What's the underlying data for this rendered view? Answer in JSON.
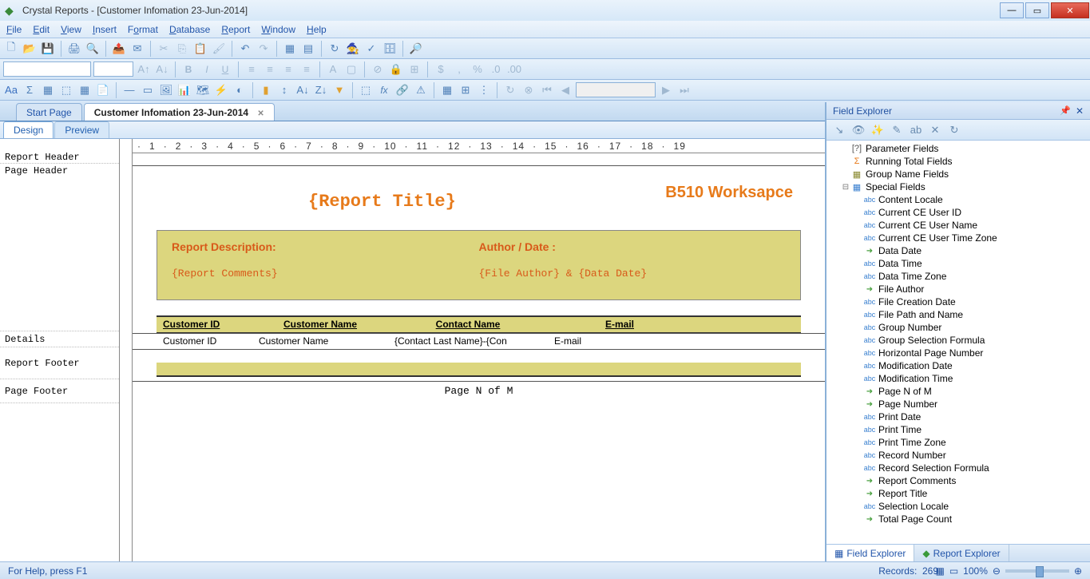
{
  "app": {
    "title": "Crystal Reports - [Customer Infomation 23-Jun-2014]"
  },
  "menu": [
    "File",
    "Edit",
    "View",
    "Insert",
    "Format",
    "Database",
    "Report",
    "Window",
    "Help"
  ],
  "tabs": {
    "start": "Start Page",
    "doc": "Customer Infomation 23-Jun-2014"
  },
  "subtabs": {
    "design": "Design",
    "preview": "Preview"
  },
  "sections": {
    "report_header": "Report Header",
    "page_header": "Page Header",
    "details": "Details",
    "report_footer": "Report Footer",
    "page_footer": "Page Footer"
  },
  "design": {
    "report_title": "{Report Title}",
    "workspace": "B510 Worksapce",
    "info": {
      "desc_label": "Report Description:",
      "author_label": "Author / Date :",
      "comments": "{Report Comments}",
      "author_fields": "{File Author} & {Data Date}"
    },
    "columns": {
      "cust_id": "Customer ID",
      "cust_name": "Customer Name",
      "contact": "Contact Name",
      "email": "E-mail"
    },
    "detail_fields": {
      "cust_id": "Customer ID",
      "cust_name": "Customer Name",
      "contact": "{Contact Last Name}-{Con",
      "email": "E-mail"
    },
    "page_n": "Page N of M"
  },
  "panel": {
    "title": "Field Explorer",
    "groups": {
      "parameter": "Parameter Fields",
      "running": "Running Total Fields",
      "group_name": "Group Name Fields",
      "special": "Special Fields"
    },
    "special_fields": [
      {
        "icon": "abc",
        "label": "Content Locale"
      },
      {
        "icon": "abc",
        "label": "Current CE User ID"
      },
      {
        "icon": "abc",
        "label": "Current CE User Name"
      },
      {
        "icon": "abc",
        "label": "Current CE User Time Zone"
      },
      {
        "icon": "arrow",
        "label": "Data Date"
      },
      {
        "icon": "abc",
        "label": "Data Time"
      },
      {
        "icon": "abc",
        "label": "Data Time Zone"
      },
      {
        "icon": "arrow",
        "label": "File Author"
      },
      {
        "icon": "abc",
        "label": "File Creation Date"
      },
      {
        "icon": "abc",
        "label": "File Path and Name"
      },
      {
        "icon": "abc",
        "label": "Group Number"
      },
      {
        "icon": "abc",
        "label": "Group Selection Formula"
      },
      {
        "icon": "abc",
        "label": "Horizontal Page Number"
      },
      {
        "icon": "abc",
        "label": "Modification Date"
      },
      {
        "icon": "abc",
        "label": "Modification Time"
      },
      {
        "icon": "arrow",
        "label": "Page N of M"
      },
      {
        "icon": "arrow",
        "label": "Page Number"
      },
      {
        "icon": "abc",
        "label": "Print Date"
      },
      {
        "icon": "abc",
        "label": "Print Time"
      },
      {
        "icon": "abc",
        "label": "Print Time Zone"
      },
      {
        "icon": "abc",
        "label": "Record Number"
      },
      {
        "icon": "abc",
        "label": "Record Selection Formula"
      },
      {
        "icon": "arrow",
        "label": "Report Comments"
      },
      {
        "icon": "arrow",
        "label": "Report Title"
      },
      {
        "icon": "abc",
        "label": "Selection Locale"
      },
      {
        "icon": "arrow",
        "label": "Total Page Count"
      }
    ],
    "tabs": {
      "field": "Field Explorer",
      "report": "Report Explorer"
    }
  },
  "status": {
    "help": "For Help, press F1",
    "records_label": "Records:",
    "records": "269",
    "zoom": "100%"
  }
}
